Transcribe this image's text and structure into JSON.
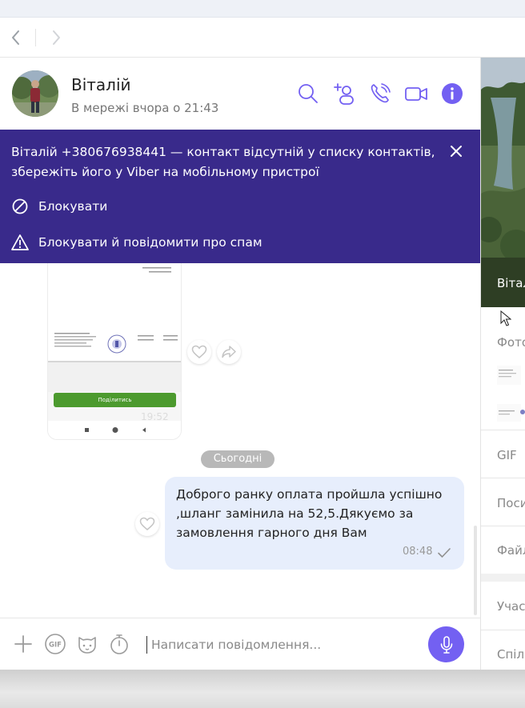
{
  "contact": {
    "name": "Віталій",
    "status": "В мережі вчора о 21:43"
  },
  "banner": {
    "text": "Віталій +380676938441 — контакт відсутній у списку контактів, збережіть його у Viber на мобільному пристрої",
    "block_label": "Блокувати",
    "block_spam_label": "Блокувати й повідомити про спам"
  },
  "image_message": {
    "share_label": "Поділитись",
    "time": "19:52"
  },
  "date_separator": "Сьогодні",
  "message": {
    "text": "Доброго ранку оплата пройшла успішно ,шланг замінила на 52,5.Дякуємо за замовлення гарного дня Вам",
    "time": "08:48"
  },
  "composer": {
    "placeholder": "Написати повідомлення...",
    "gif_label": "GIF"
  },
  "side_panel": {
    "name": "Віталій",
    "photos_label": "Фото",
    "gif_label": "GIF",
    "links_label": "Посилання",
    "files_label": "Файли",
    "participants_label": "Учасники",
    "shared_label": "Спільні групи"
  },
  "colors": {
    "accent": "#7360f2",
    "banner_bg": "#392a8b",
    "bubble_bg": "#e7eefc"
  },
  "icons": {
    "back": "chevron-left-icon",
    "forward": "chevron-right-icon",
    "search": "search-icon",
    "add_participant": "add-person-icon",
    "call": "phone-icon",
    "video": "video-camera-icon",
    "info": "info-icon",
    "close": "close-icon",
    "block": "block-icon",
    "warning": "warning-icon",
    "like": "heart-icon",
    "share": "share-icon",
    "attach": "plus-icon",
    "gif": "gif-icon",
    "sticker": "sticker-icon",
    "timer": "timer-icon",
    "mic": "microphone-icon"
  }
}
